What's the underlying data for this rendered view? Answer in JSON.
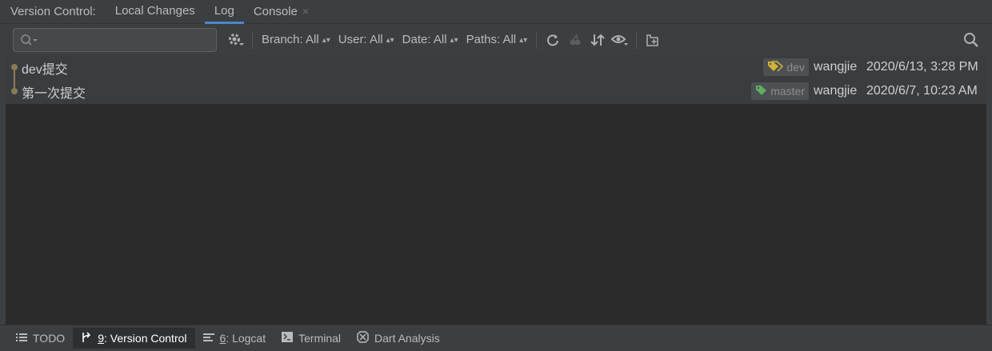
{
  "tabs": {
    "prefix": "Version Control:",
    "items": [
      {
        "label": "Local Changes"
      },
      {
        "label": "Log"
      },
      {
        "label": "Console"
      }
    ],
    "close_glyph": "×"
  },
  "toolbar": {
    "search": {
      "value": "",
      "placeholder": ""
    },
    "filters": [
      {
        "label": "Branch: All"
      },
      {
        "label": "User: All"
      },
      {
        "label": "Date: All"
      },
      {
        "label": "Paths: All"
      }
    ],
    "icons": [
      "settings-gear-icon",
      "refresh-icon",
      "cherry-pick-icon",
      "sort-arrows-icon",
      "eye-icon",
      "new-tab-icon",
      "search-icon"
    ]
  },
  "commits": [
    {
      "message": "dev提交",
      "ref": "dev",
      "author": "wangjie",
      "date": "2020/6/13, 3:28 PM",
      "ref_color": "#d1b437"
    },
    {
      "message": "第一次提交",
      "ref": "master",
      "author": "wangjie",
      "date": "2020/6/7, 10:23 AM",
      "ref_color": "#5fae5f"
    }
  ],
  "bottombar": {
    "items": [
      {
        "key": "",
        "label": "TODO"
      },
      {
        "key": "9",
        "label": ": Version Control"
      },
      {
        "key": "6",
        "label": ": Logcat"
      },
      {
        "key": "",
        "label": "Terminal"
      },
      {
        "key": "",
        "label": "Dart Analysis"
      }
    ]
  },
  "colors": {
    "accent": "#4a88c7",
    "background": "#3c3f41",
    "list_bg": "#2b2b2b"
  }
}
